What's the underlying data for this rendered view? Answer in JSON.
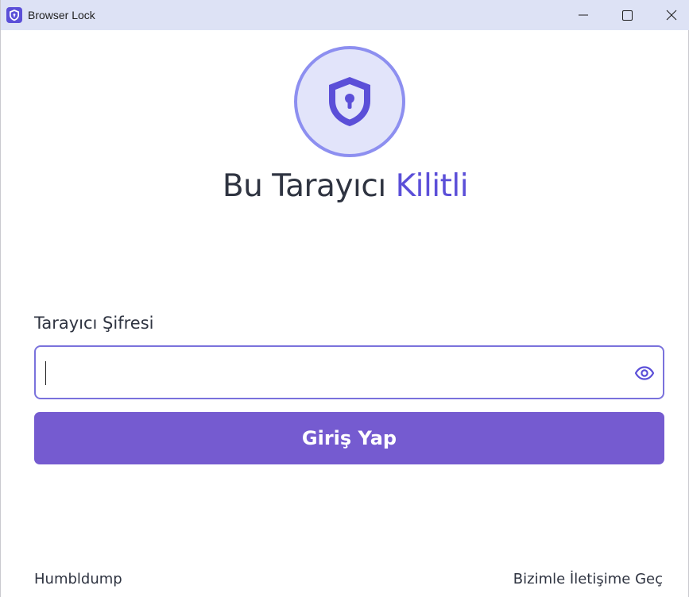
{
  "window": {
    "title": "Browser Lock",
    "app_icon": "shield-icon",
    "controls": {
      "minimize_icon": "minimize-icon",
      "maximize_icon": "maximize-icon",
      "close_icon": "close-icon"
    }
  },
  "lock_screen": {
    "logo_icon": "shield-keyhole-icon",
    "headline_prefix": "Bu Tarayıcı",
    "headline_accent": "Kilitli",
    "password_label": "Tarayıcı Şifresi",
    "password_value": "",
    "password_placeholder": "",
    "reveal_icon": "eye-icon",
    "login_button_label": "Giriş Yap"
  },
  "footer": {
    "left_text": "Humbldump",
    "contact_link": "Bizimle İletişime Geç"
  },
  "colors": {
    "titlebar_bg": "#dde2f5",
    "accent": "#5b4fd8",
    "button_bg": "#755bd0",
    "logo_circle_bg": "#e2e4fa",
    "logo_circle_border": "#8d8ff0",
    "text": "#2f3441"
  }
}
